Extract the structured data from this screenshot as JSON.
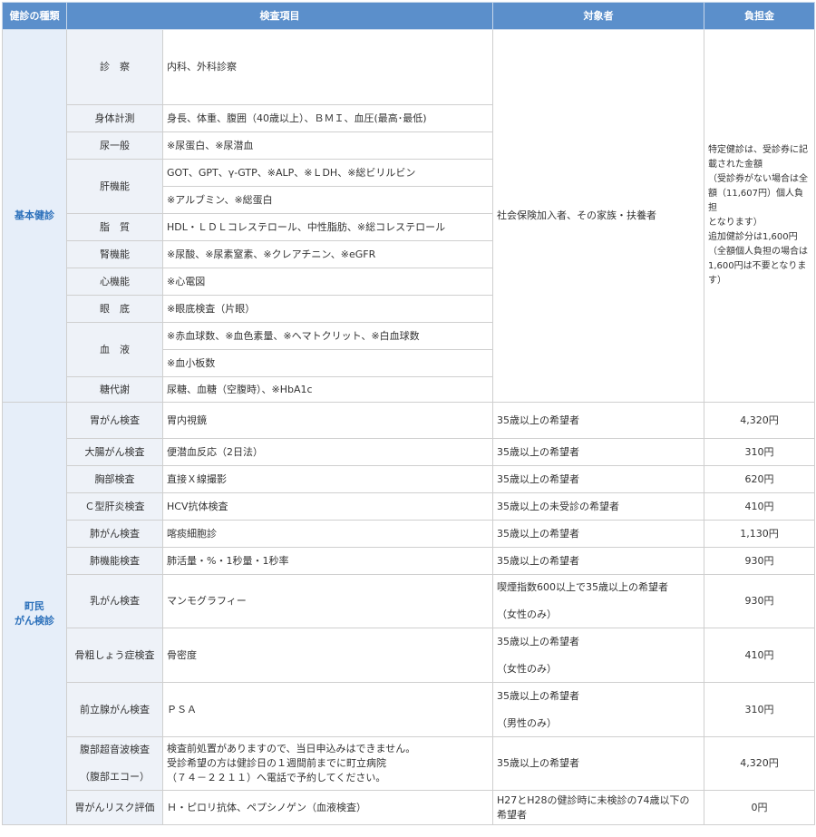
{
  "headers": {
    "type": "健診の種類",
    "item": "検査項目",
    "target": "対象者",
    "fee": "負担金"
  },
  "basic": {
    "category": "基本健診",
    "target": "社会保険加入者、その家族・扶養者",
    "fee_lines": [
      "特定健診は、受診券に記",
      "載された金額",
      "（受診券がない場合は全",
      "額（11,607円）個人負担",
      "となります）",
      "追加健診分は1,600円",
      "（全額個人負担の場合は",
      "1,600円は不要となりま",
      "す）"
    ],
    "rows": [
      {
        "item": "診　察",
        "details": [
          "内科、外科診察"
        ]
      },
      {
        "item": "身体計測",
        "details": [
          "身長、体重、腹囲（40歳以上）、ＢＭＩ、血圧(最高･最低)"
        ]
      },
      {
        "item": "尿一般",
        "details": [
          "※尿蛋白、※尿潜血"
        ]
      },
      {
        "item": "肝機能",
        "details": [
          "GOT、GPT、γ-GTP、※ALP、※ＬDH、※総ビリルビン",
          "※アルブミン、※総蛋白"
        ]
      },
      {
        "item": "脂　質",
        "details": [
          "HDL・ＬＤＬコレステロール、中性脂肪、※総コレステロール"
        ]
      },
      {
        "item": "腎機能",
        "details": [
          "※尿酸、※尿素窒素、※クレアチニン、※eGFR"
        ]
      },
      {
        "item": "心機能",
        "details": [
          "※心電図"
        ]
      },
      {
        "item": "眼　底",
        "details": [
          "※眼底検査（片眼）"
        ]
      },
      {
        "item": "血　液",
        "details": [
          "※赤血球数、※血色素量、※ヘマトクリット、※白血球数",
          "※血小板数"
        ]
      },
      {
        "item": "糖代謝",
        "details": [
          "尿糖、血糖（空腹時）、※HbA1c"
        ]
      }
    ]
  },
  "cancer": {
    "category_line1": "町民",
    "category_line2": "がん検診",
    "rows": [
      {
        "item": "胃がん検査",
        "detail": "胃内視鏡",
        "target": "35歳以上の希望者",
        "fee": "4,320円"
      },
      {
        "item": "大腸がん検査",
        "detail": "便潜血反応（2日法）",
        "target": "35歳以上の希望者",
        "fee": "310円"
      },
      {
        "item": "胸部検査",
        "detail": "直接Ｘ線撮影",
        "target": "35歳以上の希望者",
        "fee": "620円"
      },
      {
        "item": "Ｃ型肝炎検査",
        "detail": "HCV抗体検査",
        "target": "35歳以上の未受診の希望者",
        "fee": "410円"
      },
      {
        "item": "肺がん検査",
        "detail": "喀痰細胞診",
        "target": "35歳以上の希望者",
        "fee": "1,130円"
      },
      {
        "item": "肺機能検査",
        "detail": "肺活量・%・1秒量・1秒率",
        "target": "35歳以上の希望者",
        "fee": "930円"
      },
      {
        "item": "乳がん検査",
        "detail": "マンモグラフィー",
        "target": "喫煙指数600以上で35歳以上の希望者",
        "target_note": "（女性のみ）",
        "fee": "930円"
      },
      {
        "item": "骨粗しょう症検査",
        "detail": "骨密度",
        "target": "35歳以上の希望者",
        "target_note": "（女性のみ）",
        "fee": "410円"
      },
      {
        "item": "前立腺がん検査",
        "detail": "ＰＳＡ",
        "target": "35歳以上の希望者",
        "target_note": "（男性のみ）",
        "fee": "310円"
      },
      {
        "item": "腹部超音波検査",
        "item_note": "（腹部エコー）",
        "detail_lines": [
          "検査前処置がありますので、当日申込みはできません。",
          "受診希望の方は健診日の１週間前までに町立病院",
          "（７４－２２１１）へ電話で予約してください。"
        ],
        "target": "35歳以上の希望者",
        "fee": "4,320円"
      },
      {
        "item": "胃がんリスク評価",
        "detail": "Ｈ・ピロリ抗体、ペプシノゲン（血液検査）",
        "target_lines": [
          "H27とH28の健診時に未検診の74歳以下の",
          "希望者"
        ],
        "fee": "0円"
      }
    ]
  }
}
